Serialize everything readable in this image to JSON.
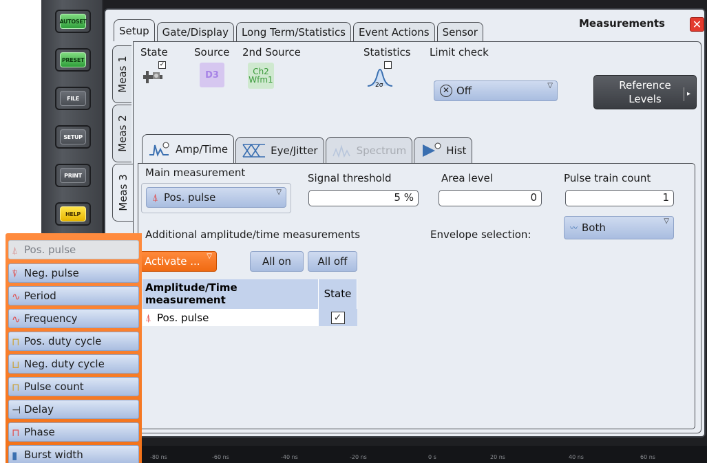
{
  "hardware_buttons": [
    {
      "label": "AUTOSET",
      "color": "green"
    },
    {
      "label": "PRESET",
      "color": "green"
    },
    {
      "label": "FILE",
      "color": "gray"
    },
    {
      "label": "SETUP",
      "color": "gray"
    },
    {
      "label": "PRINT",
      "color": "gray"
    },
    {
      "label": "HELP",
      "color": "yellow"
    }
  ],
  "time_axis": [
    "-80 ns",
    "-60 ns",
    "-40 ns",
    "-20 ns",
    "0 s",
    "20 ns",
    "40 ns",
    "60 ns"
  ],
  "dialog": {
    "title": "Measurements",
    "close_symbol": "✕",
    "top_tabs": [
      "Setup",
      "Gate/Display",
      "Long Term/Statistics",
      "Event Actions",
      "Sensor"
    ],
    "side_tabs": [
      "Meas 1",
      "Meas 2",
      "Meas 3"
    ],
    "state_label": "State",
    "source_label": "Source",
    "source_value": "D3",
    "second_source_label": "2nd Source",
    "second_source_value": "Ch2",
    "second_source_sub": "Wfm1",
    "statistics_label": "Statistics",
    "statistics_icon_text": "2σ",
    "limit_check_label": "Limit check",
    "limit_check_value": "Off",
    "reference_levels_line1": "Reference",
    "reference_levels_line2": "Levels",
    "inner_tabs": [
      "Amp/Time",
      "Eye/Jitter",
      "Spectrum",
      "Hist"
    ],
    "main_measurement_label": "Main measurement",
    "main_measurement_value": "Pos. pulse",
    "signal_threshold_label": "Signal threshold",
    "signal_threshold_value": "5 %",
    "area_level_label": "Area level",
    "area_level_value": "0",
    "pulse_train_count_label": "Pulse train count",
    "pulse_train_count_value": "1",
    "envelope_selection_label": "Envelope selection:",
    "envelope_selection_value": "Both",
    "additional_label": "Additional amplitude/time measurements",
    "activate_label": "Activate ...",
    "all_on_label": "All on",
    "all_off_label": "All off",
    "table": {
      "header_measurement": "Amplitude/Time measurement",
      "header_state": "State",
      "rows": [
        {
          "measurement": "Pos. pulse",
          "state": "✓"
        }
      ]
    }
  },
  "dropdown_items": [
    {
      "label": "Pos. pulse",
      "enabled": false
    },
    {
      "label": "Neg. pulse",
      "enabled": true
    },
    {
      "label": "Period",
      "enabled": true
    },
    {
      "label": "Frequency",
      "enabled": true
    },
    {
      "label": "Pos. duty cycle",
      "enabled": true
    },
    {
      "label": "Neg. duty cycle",
      "enabled": true
    },
    {
      "label": "Pulse count",
      "enabled": true
    },
    {
      "label": "Delay",
      "enabled": true
    },
    {
      "label": "Phase",
      "enabled": true
    },
    {
      "label": "Burst width",
      "enabled": true
    }
  ],
  "colors": {
    "accent_orange": "#f27219",
    "selector_blue": "#a9bde0",
    "close_red": "#e33b2e"
  }
}
